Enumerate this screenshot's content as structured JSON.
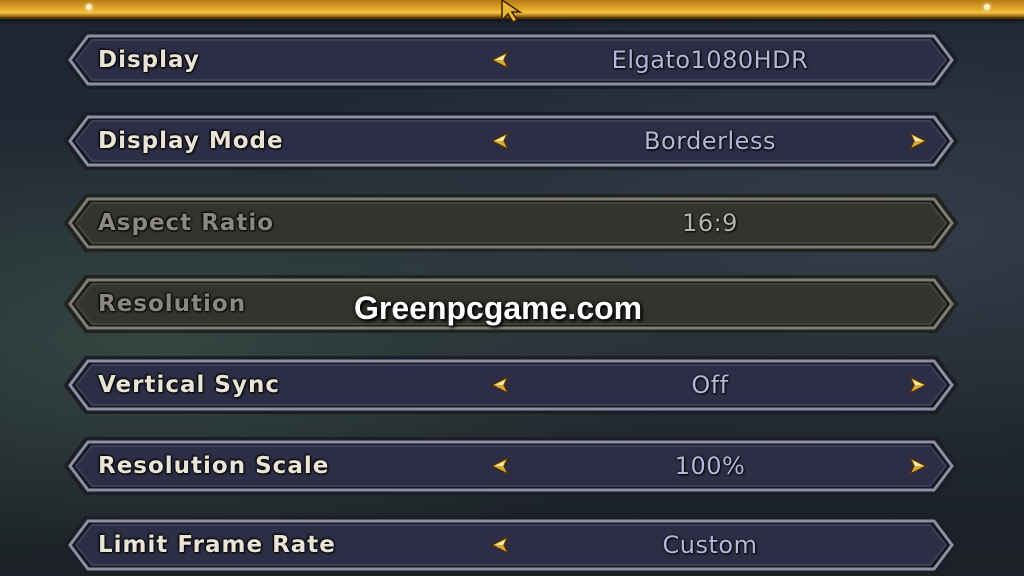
{
  "settings": [
    {
      "label": "Display",
      "value": "Elgato1080HDR",
      "left_arrow": true,
      "right_arrow": false,
      "enabled": true
    },
    {
      "label": "Display Mode",
      "value": "Borderless",
      "left_arrow": true,
      "right_arrow": true,
      "enabled": true
    },
    {
      "label": "Aspect Ratio",
      "value": "16:9",
      "left_arrow": false,
      "right_arrow": false,
      "enabled": false
    },
    {
      "label": "Resolution",
      "value": "",
      "left_arrow": false,
      "right_arrow": false,
      "enabled": false
    },
    {
      "label": "Vertical Sync",
      "value": "Off",
      "left_arrow": true,
      "right_arrow": true,
      "enabled": true
    },
    {
      "label": "Resolution Scale",
      "value": "100%",
      "left_arrow": true,
      "right_arrow": true,
      "enabled": true
    },
    {
      "label": "Limit Frame Rate",
      "value": "Custom",
      "left_arrow": true,
      "right_arrow": false,
      "enabled": true
    }
  ],
  "watermark": "Greenpcgame.com",
  "icons": {
    "left_arrow": "arrow-left-icon",
    "right_arrow": "arrow-right-icon",
    "cursor": "mouse-cursor-icon"
  },
  "colors": {
    "gold_bar": "#e0a62a",
    "row_fill": "#2d2e45",
    "row_fill_disabled": "#34342f",
    "label": "#e9e4d6",
    "value": "#b7b5dc"
  }
}
